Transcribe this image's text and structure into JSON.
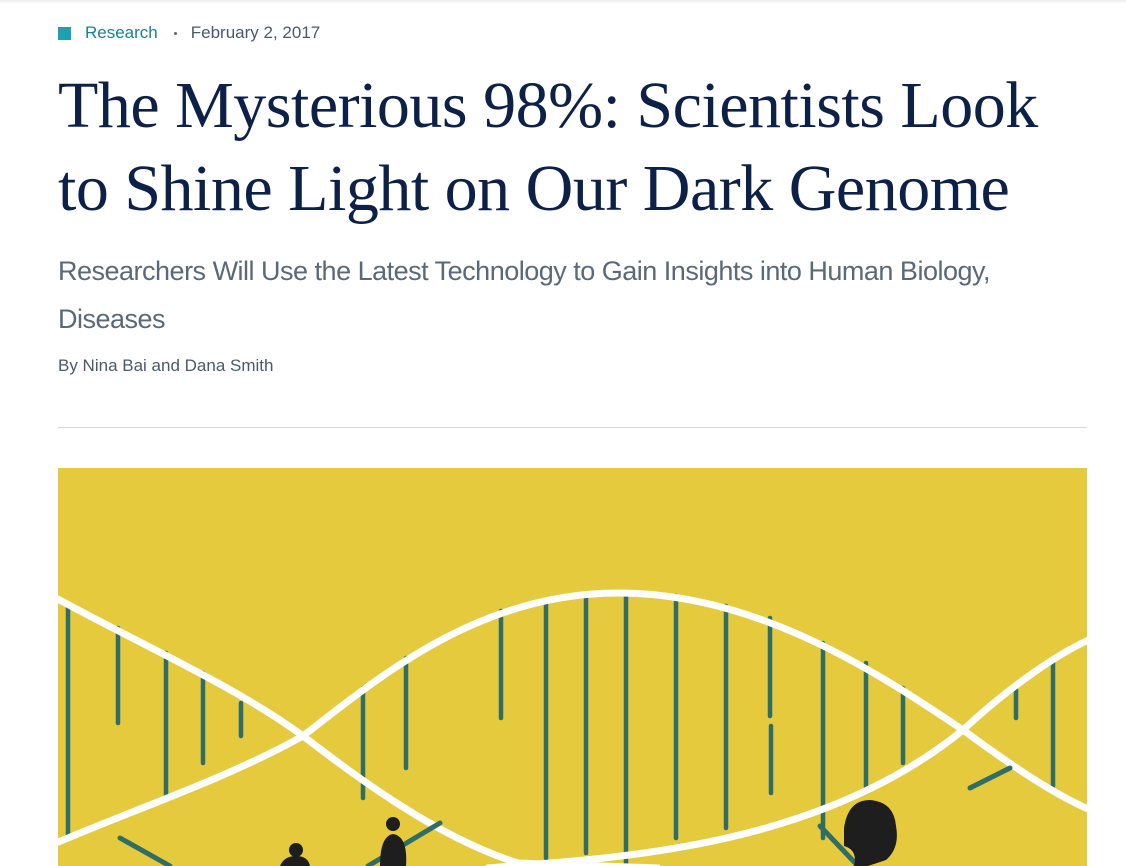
{
  "article": {
    "category": "Research",
    "date": "February 2, 2017",
    "title": "The Mysterious 98%: Scientists Look to Shine Light on Our Dark Genome",
    "subtitle": "Researchers Will Use the Latest Technology to Gain Insights into Human Biology, Diseases",
    "byline": "By Nina Bai and Dana Smith"
  },
  "colors": {
    "category_accent": "#19a3b0",
    "headline": "#0d2148",
    "hero_background": "#e5ca3d",
    "dna_rungs": "#2f6d66",
    "silhouettes": "#1e1e1e"
  },
  "hero_image": {
    "icon": "dna-helix-illustration"
  }
}
